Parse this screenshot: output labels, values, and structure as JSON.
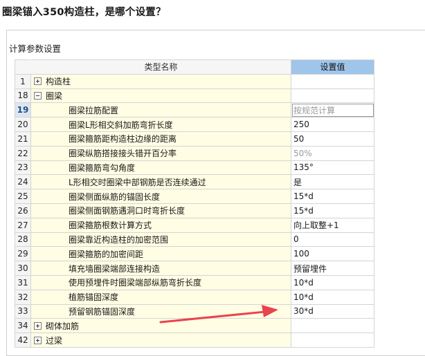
{
  "question": "圈梁锚入350构造柱，是哪个设置？",
  "panel": {
    "title": "计算参数设置"
  },
  "table": {
    "header": {
      "name": "类型名称",
      "value": "设置值"
    },
    "rows": [
      {
        "num": "1",
        "name": "构造柱",
        "value": "",
        "type": "group",
        "expander": "plus"
      },
      {
        "num": "18",
        "name": "圈梁",
        "value": "",
        "type": "group",
        "expander": "minus"
      },
      {
        "num": "19",
        "name": "圈梁拉筋配置",
        "value": "按规范计算",
        "type": "item",
        "selected": true,
        "gray": true
      },
      {
        "num": "20",
        "name": "圈梁L形相交斜加筋弯折长度",
        "value": "250",
        "type": "item"
      },
      {
        "num": "21",
        "name": "圈梁箍筋距构造柱边缘的距离",
        "value": "50",
        "type": "item"
      },
      {
        "num": "22",
        "name": "圈梁纵筋搭接接头错开百分率",
        "value": "50%",
        "type": "item",
        "gray": true
      },
      {
        "num": "23",
        "name": "圈梁箍筋弯勾角度",
        "value": "135°",
        "type": "item"
      },
      {
        "num": "24",
        "name": "L形相交时圈梁中部钢筋是否连续通过",
        "value": "是",
        "type": "item"
      },
      {
        "num": "25",
        "name": "圈梁侧面纵筋的锚固长度",
        "value": "15*d",
        "type": "item"
      },
      {
        "num": "26",
        "name": "圈梁侧面钢筋遇洞口时弯折长度",
        "value": "15*d",
        "type": "item"
      },
      {
        "num": "27",
        "name": "圈梁箍筋根数计算方式",
        "value": "向上取整+1",
        "type": "item"
      },
      {
        "num": "28",
        "name": "圈梁靠近构造柱的加密范围",
        "value": "0",
        "type": "item"
      },
      {
        "num": "29",
        "name": "圈梁箍筋的加密间距",
        "value": "100",
        "type": "item"
      },
      {
        "num": "30",
        "name": "填充墙圈梁端部连接构造",
        "value": "预留埋件",
        "type": "item"
      },
      {
        "num": "31",
        "name": "使用预埋件时圈梁端部纵筋弯折长度",
        "value": "10*d",
        "type": "item"
      },
      {
        "num": "32",
        "name": "植筋锚固深度",
        "value": "10*d",
        "type": "item"
      },
      {
        "num": "33",
        "name": "预留钢筋锚固深度",
        "value": "30*d",
        "type": "item"
      },
      {
        "num": "34",
        "name": "砌体加筋",
        "value": "",
        "type": "group",
        "expander": "plus"
      },
      {
        "num": "42",
        "name": "过梁",
        "value": "",
        "type": "group",
        "expander": "plus"
      }
    ]
  },
  "annotation": {
    "color": "#e8444d"
  }
}
